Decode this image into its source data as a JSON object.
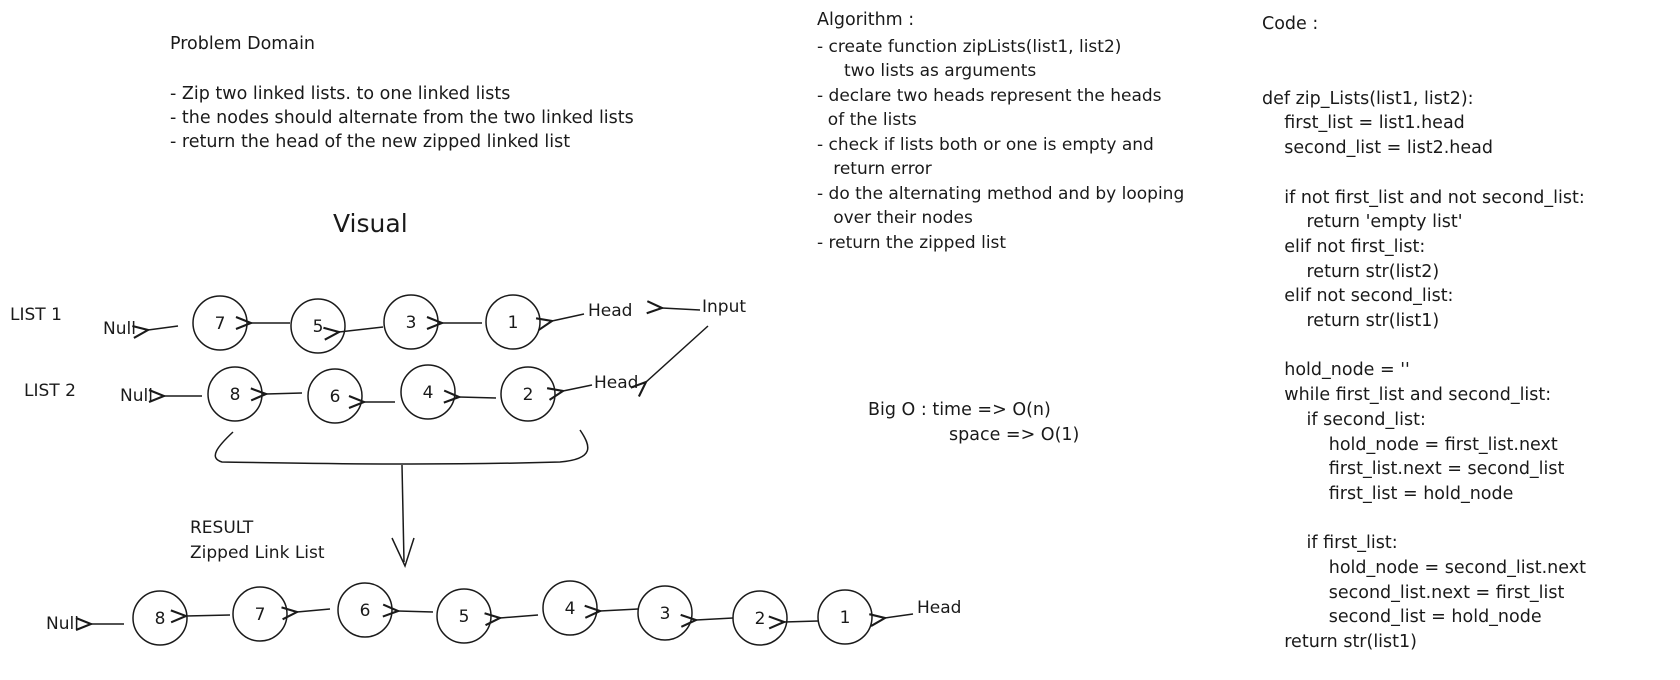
{
  "problem": {
    "title": "Problem Domain",
    "items": [
      "- Zip two linked lists. to one linked lists",
      "- the nodes should alternate from the two linked lists",
      "- return the head of the new zipped linked list"
    ]
  },
  "visual_title": "Visual",
  "algorithm": {
    "title": "Algorithm :",
    "lines": [
      "- create function zipLists(list1, list2)",
      "     two lists as arguments",
      "- declare two heads represent the heads",
      "  of the lists",
      "- check if lists both or one is empty and",
      "   return error",
      "- do the alternating method and by looping",
      "   over their nodes",
      "- return the zipped list"
    ]
  },
  "big_o": {
    "line1": "Big O : time => O(n)",
    "line2": "space => O(1)"
  },
  "code": {
    "title": "Code :",
    "lines": [
      "def zip_Lists(list1, list2):",
      "    first_list = list1.head",
      "    second_list = list2.head",
      "",
      "    if not first_list and not second_list:",
      "        return 'empty list'",
      "    elif not first_list:",
      "        return str(list2)",
      "    elif not second_list:",
      "        return str(list1)",
      "",
      "    hold_node = ''",
      "    while first_list and second_list:",
      "        if second_list:",
      "            hold_node = first_list.next",
      "            first_list.next = second_list",
      "            first_list = hold_node",
      "",
      "        if first_list:",
      "            hold_node = second_list.next",
      "            second_list.next = first_list",
      "            second_list = hold_node",
      "    return str(list1)"
    ]
  },
  "list1": {
    "label": "LIST 1",
    "null": "Null",
    "head": "Head",
    "nodes": [
      "7",
      "5",
      "3",
      "1"
    ]
  },
  "list2": {
    "label": "LIST 2",
    "null": "Null",
    "head": "Head",
    "nodes": [
      "8",
      "6",
      "4",
      "2"
    ]
  },
  "input_label": "Input",
  "result": {
    "label1": "RESULT",
    "label2": "Zipped Link List",
    "null": "Null",
    "head": "Head",
    "nodes": [
      "8",
      "7",
      "6",
      "5",
      "4",
      "3",
      "2",
      "1"
    ]
  }
}
